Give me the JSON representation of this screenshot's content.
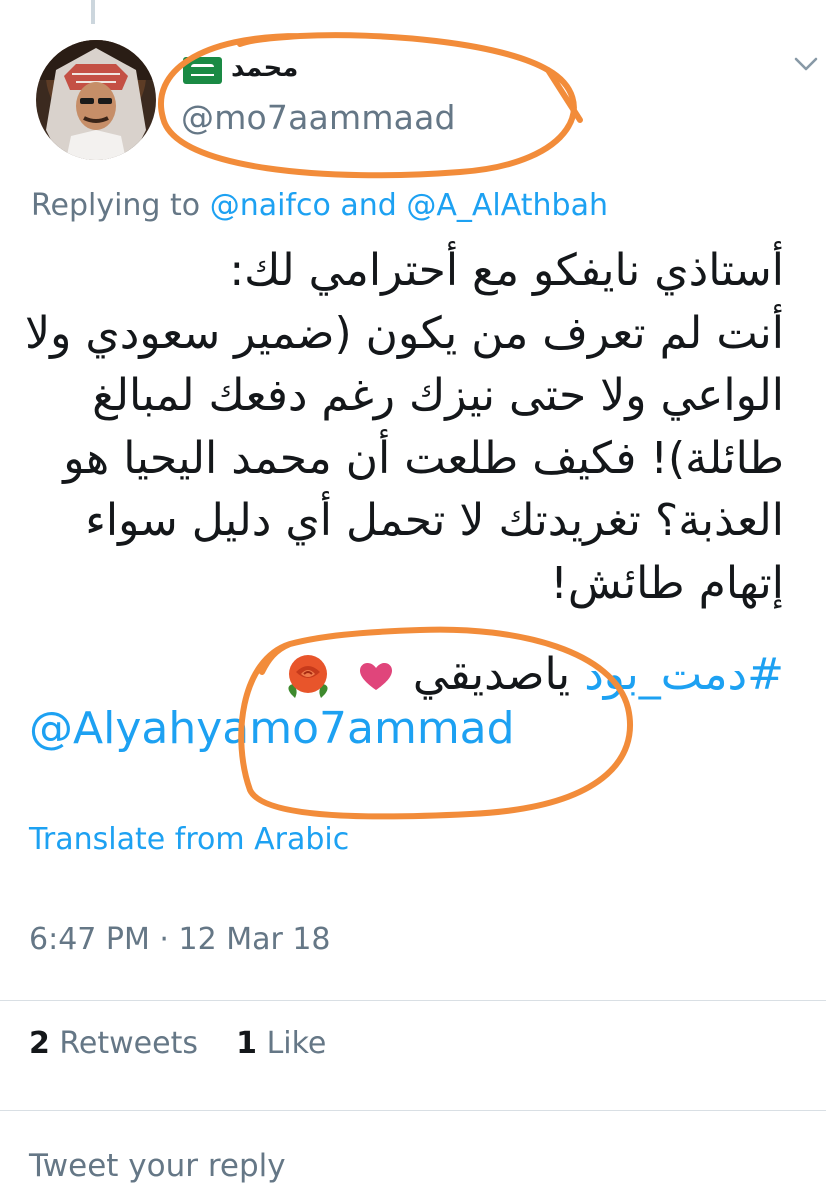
{
  "author": {
    "display_name": "محمد",
    "handle": "@mo7aammaad",
    "flag_icon": "saudi-flag-icon",
    "menu_icon": "chevron-down-icon"
  },
  "replying_to": {
    "prefix": "Replying to",
    "mention_1": "@naifco",
    "conjunction": "and",
    "mention_2": "@A_AlAthbah"
  },
  "tweet": {
    "lines": [
      "أستاذي نايفكو مع أحترامي لك:",
      "أنت لم تعرف من يكون (ضمير سعودي ولا",
      "الواعي ولا حتى نيزك رغم دفعك لمبالغ",
      "طائلة)! فكيف طلعت أن محمد اليحيا هو",
      "العذبة؟ تغريدتك لا تحمل أي دليل سواء",
      "إتهام طائش!"
    ],
    "hashtag": "#دمت_بود",
    "hashtag_suffix": "ياصديقي",
    "emojis": [
      "heart-icon",
      "rose-icon"
    ],
    "mention": "@Alyahyamo7ammad"
  },
  "translate_label": "Translate from Arabic",
  "timestamp": "6:47 PM · 12 Mar 18",
  "stats": {
    "retweets_count": "2",
    "retweets_label": "Retweets",
    "likes_count": "1",
    "likes_label": "Like"
  },
  "reply_placeholder": "Tweet your reply",
  "colors": {
    "link": "#1da1f2",
    "muted": "#657786",
    "text": "#14171a",
    "annotation": "#f28c3a"
  }
}
